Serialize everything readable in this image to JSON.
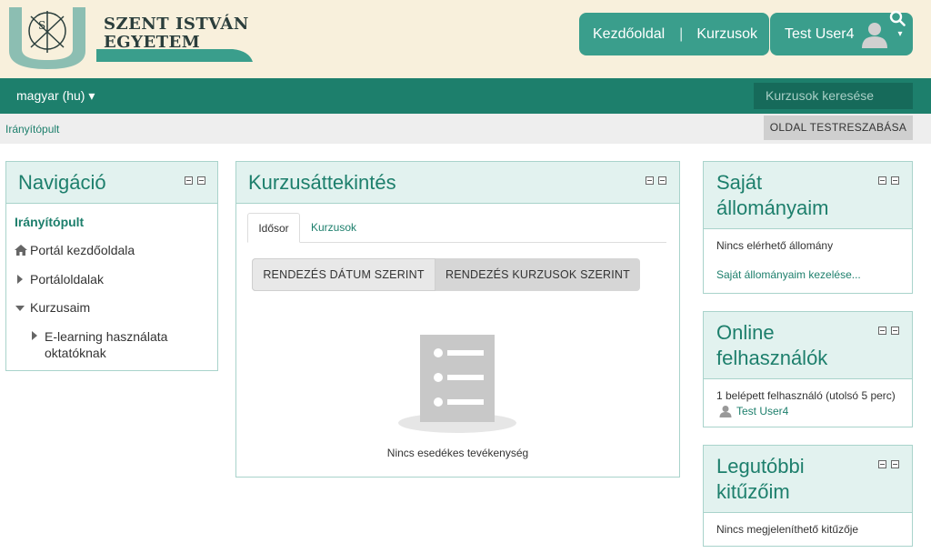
{
  "header": {
    "logo_line1": "SZENT ISTVÁN",
    "logo_line2": "EGYETEM",
    "nav_home": "Kezdőoldal",
    "nav_separator": "|",
    "nav_courses": "Kurzusok",
    "user_name": "Test User4",
    "user_caret": "▾"
  },
  "navbar": {
    "language": "magyar (hu) ▾",
    "search_placeholder": "Kurzusok keresése"
  },
  "breadcrumb": {
    "item": "Irányítópult",
    "customize_button": "OLDAL TESTRESZABÁSA"
  },
  "navigation_block": {
    "title": "Navigáció",
    "items": [
      {
        "label": "Irányítópult"
      },
      {
        "label": "Portál kezdőoldala"
      },
      {
        "label": "Portáloldalak"
      },
      {
        "label": "Kurzusaim"
      },
      {
        "label": "E-learning használata"
      },
      {
        "label": "oktatóknak"
      }
    ]
  },
  "overview_block": {
    "title": "Kurzusáttekintés",
    "tab_timeline": "Idősor",
    "tab_courses": "Kurzusok",
    "sort_by_date": "RENDEZÉS DÁTUM SZERINT",
    "sort_by_courses": "RENDEZÉS KURZUSOK SZERINT",
    "empty_message": "Nincs esedékes tevékenység"
  },
  "files_block": {
    "title_line1": "Saját",
    "title_line2": "állományaim",
    "empty": "Nincs elérhető állomány",
    "manage_link": "Saját állományaim kezelése..."
  },
  "online_block": {
    "title_line1": "Online",
    "title_line2": "felhasználók",
    "summary": "1 belépett felhasználó (utolsó 5 perc)",
    "user": "Test User4"
  },
  "badges_block": {
    "title_line1": "Legutóbbi",
    "title_line2": "kitűzőim",
    "empty": "Nincs megjeleníthető kitűzője"
  },
  "colors": {
    "teal": "#1d7f6c",
    "teal_light": "#3a9e8c",
    "header_bg": "#f8f0dc",
    "block_head_bg": "#e2f2ef"
  }
}
